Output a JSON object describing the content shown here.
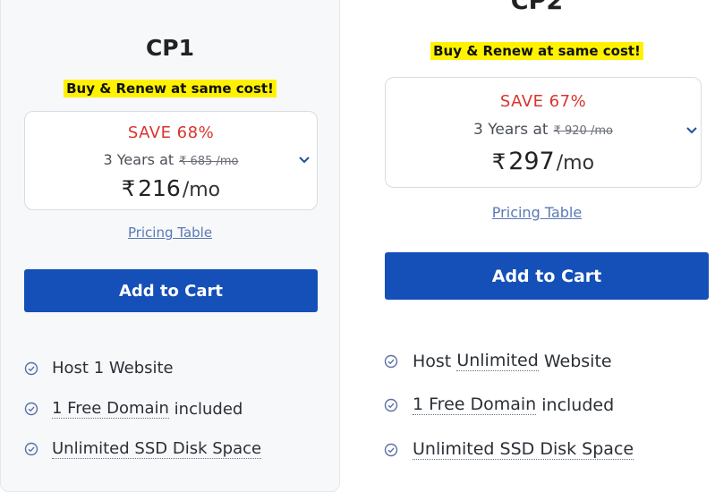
{
  "plans": [
    {
      "name": "CP1",
      "promo": "Buy & Renew at same cost!",
      "save": "SAVE 68%",
      "term": "3 Years at",
      "original_price": "₹ 685 /mo",
      "currency": "₹",
      "price": "216",
      "period": "/mo",
      "pricing_link": "Pricing Table",
      "cta": "Add to Cart",
      "features": [
        {
          "pre": "Host 1 Website",
          "dotted": "",
          "post": ""
        },
        {
          "pre": "",
          "dotted": "1 Free Domain",
          "post": " included"
        },
        {
          "pre": "",
          "dotted": "Unlimited SSD Disk Space",
          "post": ""
        }
      ]
    },
    {
      "name": "CP2",
      "promo": "Buy & Renew at same cost!",
      "save": "SAVE 67%",
      "term": "3 Years at",
      "original_price": "₹ 920 /mo",
      "currency": "₹",
      "price": "297",
      "period": "/mo",
      "pricing_link": "Pricing Table",
      "cta": "Add to Cart",
      "features": [
        {
          "pre": "Host ",
          "dotted": "Unlimited",
          "post": " Website"
        },
        {
          "pre": "",
          "dotted": "1 Free Domain",
          "post": " included"
        },
        {
          "pre": "",
          "dotted": "Unlimited SSD Disk Space",
          "post": ""
        }
      ]
    }
  ],
  "colors": {
    "accent_button": "#1550b8",
    "save_red": "#d9342b",
    "promo_highlight": "#fff200",
    "link_blue": "#5a79b5"
  },
  "icons": {
    "chevron": "chevron-down-icon",
    "check": "check-circle-icon"
  }
}
